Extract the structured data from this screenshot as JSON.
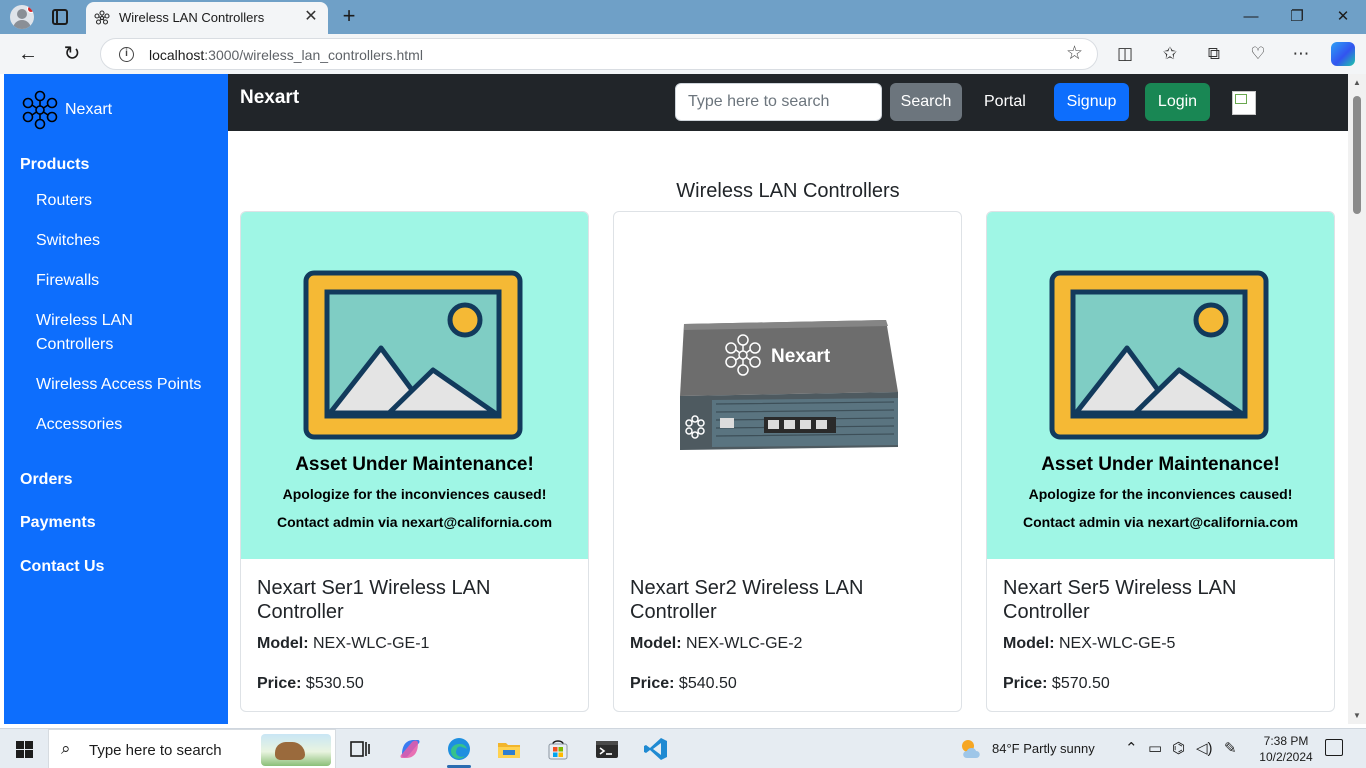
{
  "browser": {
    "tab_title": "Wireless LAN Controllers",
    "url_host": "localhost",
    "url_path": ":3000/wireless_lan_controllers.html"
  },
  "sidebar": {
    "brand": "Nexart",
    "products_heading": "Products",
    "product_items": [
      {
        "label": "Routers"
      },
      {
        "label": "Switches"
      },
      {
        "label": "Firewalls"
      },
      {
        "label": "Wireless LAN Controllers"
      },
      {
        "label": "Wireless Access Points"
      },
      {
        "label": "Accessories"
      }
    ],
    "orders": "Orders",
    "payments": "Payments",
    "contact": "Contact Us"
  },
  "topnav": {
    "brand": "Nexart",
    "search_placeholder": "Type here to search",
    "search_button": "Search",
    "portal": "Portal",
    "signup": "Signup",
    "login": "Login"
  },
  "page": {
    "title": "Wireless LAN Controllers"
  },
  "products": [
    {
      "name": "Nexart Ser1 Wireless LAN Controller",
      "model_label": "Model:",
      "model": "NEX-WLC-GE-1",
      "price_label": "Price:",
      "price": "$530.50",
      "image": "maintenance",
      "maint_title": "Asset Under Maintenance!",
      "maint_sub": "Apologize for the inconviences caused!",
      "maint_contact": "Contact admin via nexart@california.com"
    },
    {
      "name": "Nexart Ser2 Wireless LAN Controller",
      "model_label": "Model:",
      "model": "NEX-WLC-GE-2",
      "price_label": "Price:",
      "price": "$540.50",
      "image": "device",
      "device_brand": "Nexart"
    },
    {
      "name": "Nexart Ser5 Wireless LAN Controller",
      "model_label": "Model:",
      "model": "NEX-WLC-GE-5",
      "price_label": "Price:",
      "price": "$570.50",
      "image": "maintenance",
      "maint_title": "Asset Under Maintenance!",
      "maint_sub": "Apologize for the inconviences caused!",
      "maint_contact": "Contact admin via nexart@california.com"
    }
  ],
  "taskbar": {
    "search_placeholder": "Type here to search",
    "weather": "84°F  Partly sunny",
    "time": "7:38 PM",
    "date": "10/2/2024"
  },
  "colors": {
    "sidebar": "#0d6efd",
    "navbar": "#212529",
    "signup": "#0d6efd",
    "login": "#198754",
    "search_button": "#6c757d",
    "maintenance_bg": "#9ff6e5"
  }
}
